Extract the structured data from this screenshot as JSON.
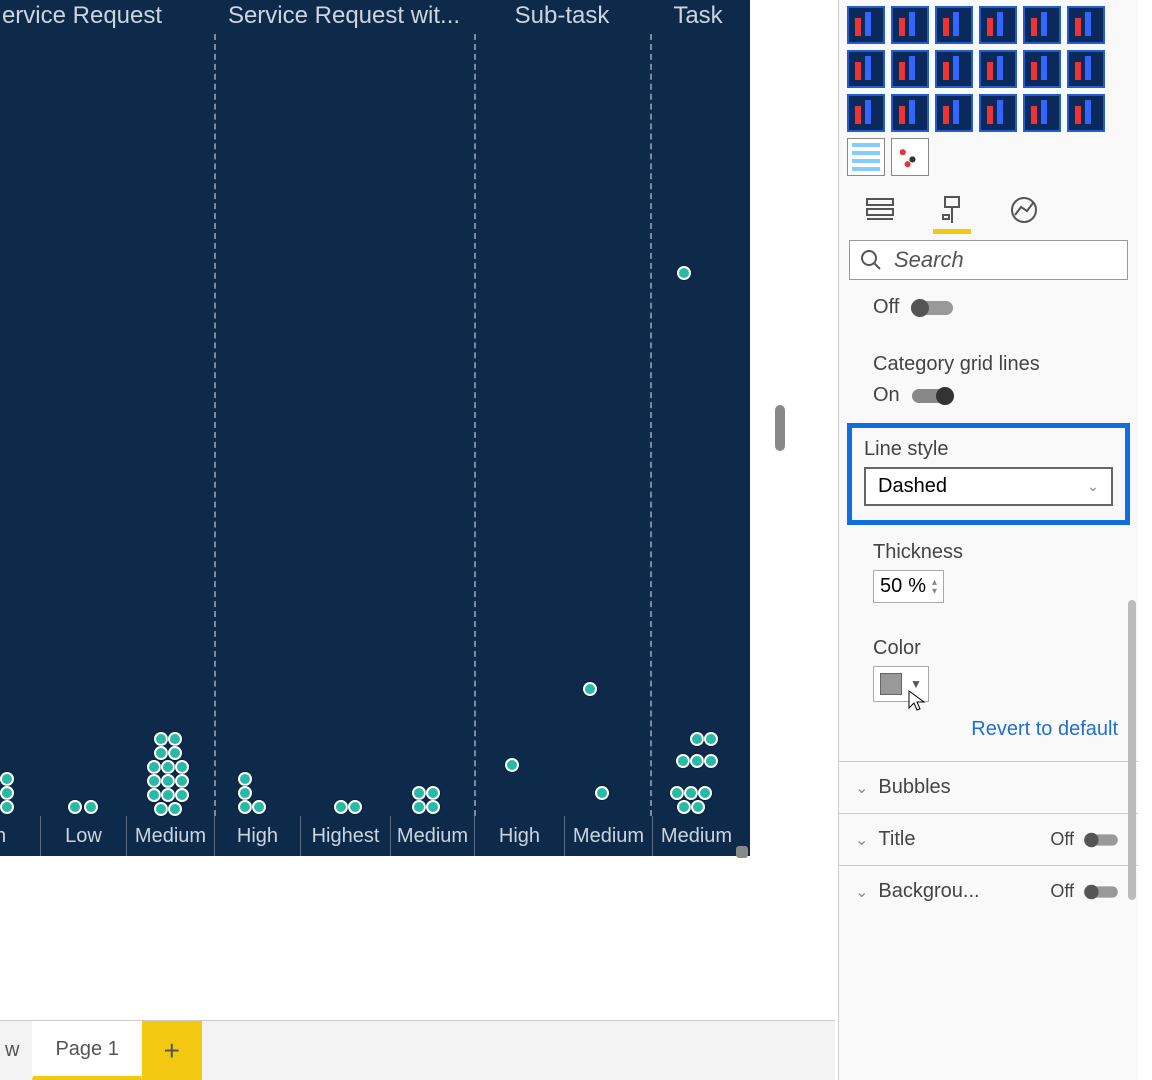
{
  "chart": {
    "headers": [
      "ervice Request",
      "Service Request wit...",
      "Sub-task",
      "Task"
    ],
    "footers": [
      "gh",
      "Low",
      "Medium",
      "High",
      "Highest",
      "Medium",
      "High",
      "Medium",
      "Medium"
    ]
  },
  "tabs": {
    "partial": "w",
    "page1": "Page 1",
    "add": "+"
  },
  "panel": {
    "search_placeholder": "Search",
    "off_label": "Off",
    "category_grid_lines": "Category grid lines",
    "on_label": "On",
    "line_style_label": "Line style",
    "line_style_value": "Dashed",
    "thickness_label": "Thickness",
    "thickness_value": "50",
    "thickness_unit": "%",
    "color_label": "Color",
    "revert": "Revert to default",
    "accordion_bubbles": "Bubbles",
    "accordion_title": "Title",
    "accordion_bg": "Backgrou...",
    "title_off": "Off",
    "bg_off": "Off"
  },
  "chart_data": {
    "type": "scatter",
    "title": "",
    "xlabel": "",
    "ylabel": "",
    "categories": [
      "Service Request",
      "Service Request wit...",
      "Sub-task",
      "Task"
    ],
    "sub_categories": [
      "gh",
      "Low",
      "Medium",
      "High",
      "Highest",
      "Medium",
      "High",
      "Medium",
      "Medium"
    ],
    "series": [
      {
        "name": "points",
        "note": "positions approximate, no axis values visible"
      }
    ]
  }
}
